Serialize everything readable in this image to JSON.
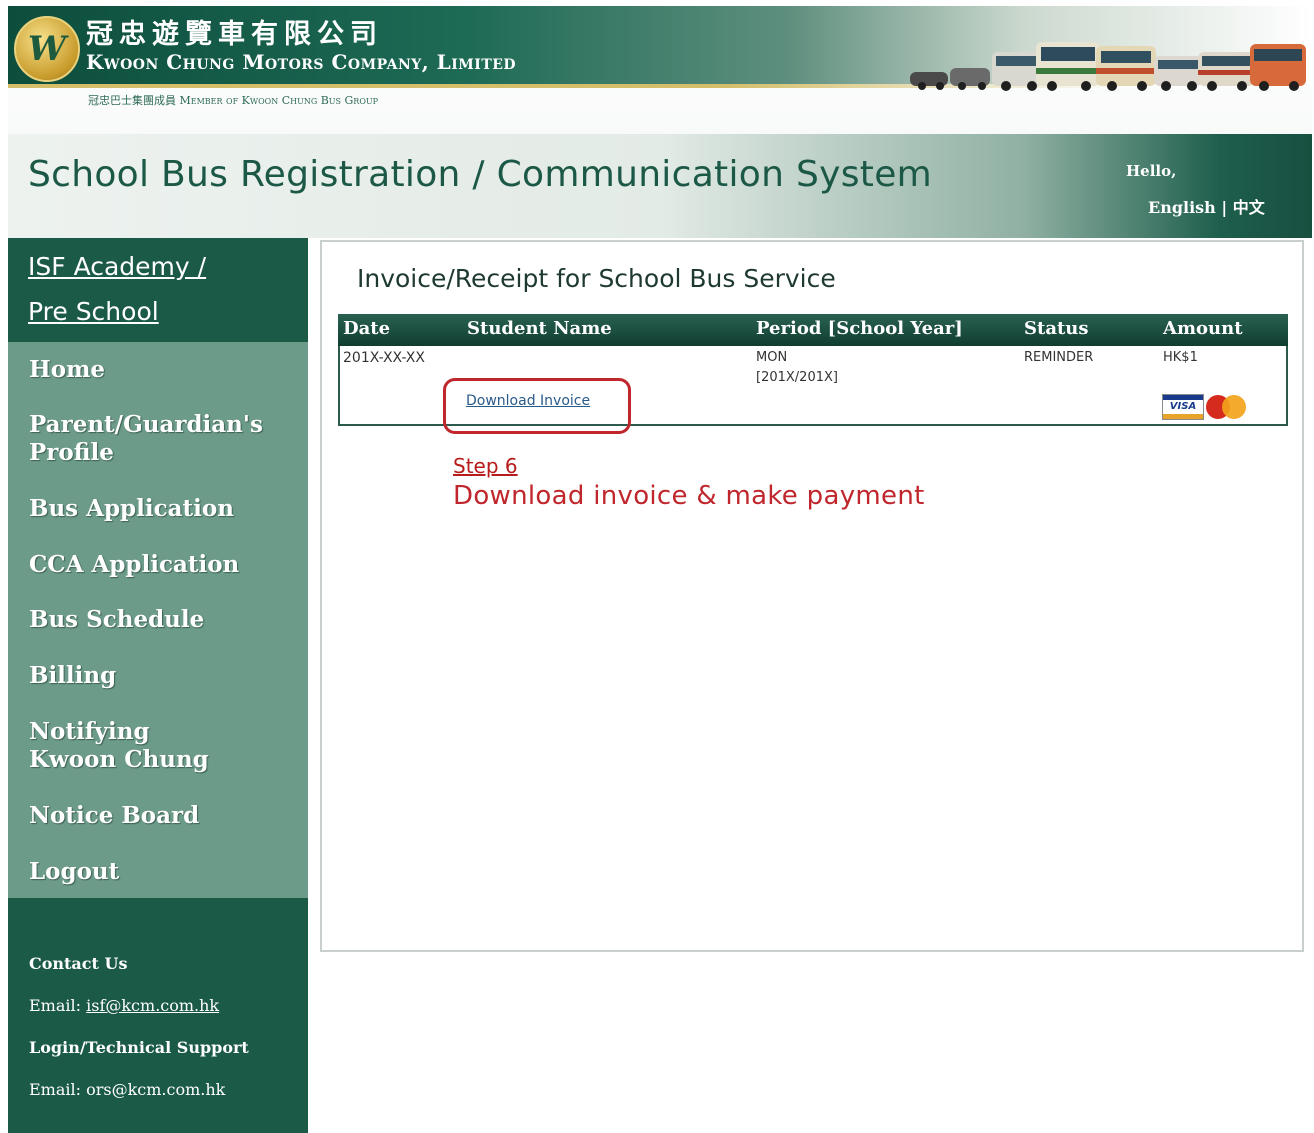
{
  "header": {
    "company_cn": "冠忠遊覽車有限公司",
    "company_en": "Kwoon Chung Motors Company, Limited",
    "member_line": "冠忠巴士集團成員  Member of  Kwoon Chung Bus Group",
    "logo_letter": "W",
    "title": "School Bus Registration / Communication System",
    "greeting": "Hello,",
    "lang_english": "English",
    "lang_separator": "|",
    "lang_chinese": "中文"
  },
  "sidebar": {
    "school_line1": "ISF Academy /",
    "school_line2": "Pre School",
    "nav": [
      {
        "label": "Home"
      },
      {
        "label": "Parent/Guardian's"
      },
      {
        "label": "Profile"
      },
      {
        "label": "Bus Application"
      },
      {
        "label": "CCA Application"
      },
      {
        "label": "Bus Schedule"
      },
      {
        "label": "Billing"
      },
      {
        "label": "Notifying"
      },
      {
        "label": "Kwoon Chung"
      },
      {
        "label": "Notice Board"
      },
      {
        "label": "Logout"
      }
    ],
    "contact_heading": "Contact Us",
    "contact_email_label": "Email:",
    "contact_email": "isf@kcm.com.hk",
    "support_heading": "Login/Technical Support",
    "support_email_label": "Email:",
    "support_email": "ors@kcm.com.hk"
  },
  "content": {
    "title": "Invoice/Receipt for School Bus Service",
    "table": {
      "headers": [
        "Date",
        "Student Name",
        "Period [School Year]",
        "Status",
        "Amount"
      ],
      "row": {
        "date": "201X-XX-XX",
        "student_name": "",
        "period_line1": "MON",
        "period_line2": "[201X/201X]",
        "status": "REMINDER",
        "amount": "HK$1",
        "download_link": "Download Invoice",
        "card_visa": "VISA"
      }
    },
    "step_label": "Step 6",
    "step_text": "Download invoice & make payment"
  },
  "colors": {
    "primary_green": "#1c5a48",
    "menu_green": "#6c9b89",
    "highlight_red": "#c0272d"
  }
}
